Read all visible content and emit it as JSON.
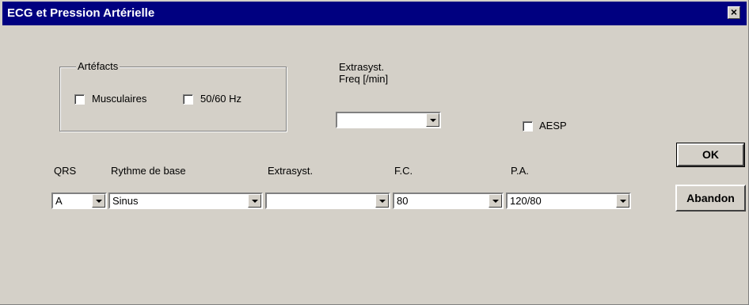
{
  "window": {
    "title": "ECG et Pression Artérielle",
    "close_glyph": "×"
  },
  "artefacts": {
    "legend": "Artéfacts",
    "musculaires": {
      "label": "Musculaires",
      "checked": false
    },
    "hz": {
      "label": "50/60 Hz",
      "checked": false
    }
  },
  "extrasyst_freq": {
    "label_line1": "Extrasyst.",
    "label_line2": "Freq [/min]",
    "value": ""
  },
  "aesp": {
    "label": "AESP",
    "checked": false
  },
  "columns": {
    "qrs": {
      "label": "QRS",
      "value": "A"
    },
    "rythme": {
      "label": "Rythme de base",
      "value": "Sinus"
    },
    "extrasyst": {
      "label": "Extrasyst.",
      "value": ""
    },
    "fc": {
      "label": "F.C.",
      "value": "80"
    },
    "pa": {
      "label": "P.A.",
      "value": "120/80"
    }
  },
  "buttons": {
    "ok": "OK",
    "cancel": "Abandon"
  },
  "icons": {
    "dropdown": "chevron-down-icon",
    "close": "close-icon"
  }
}
